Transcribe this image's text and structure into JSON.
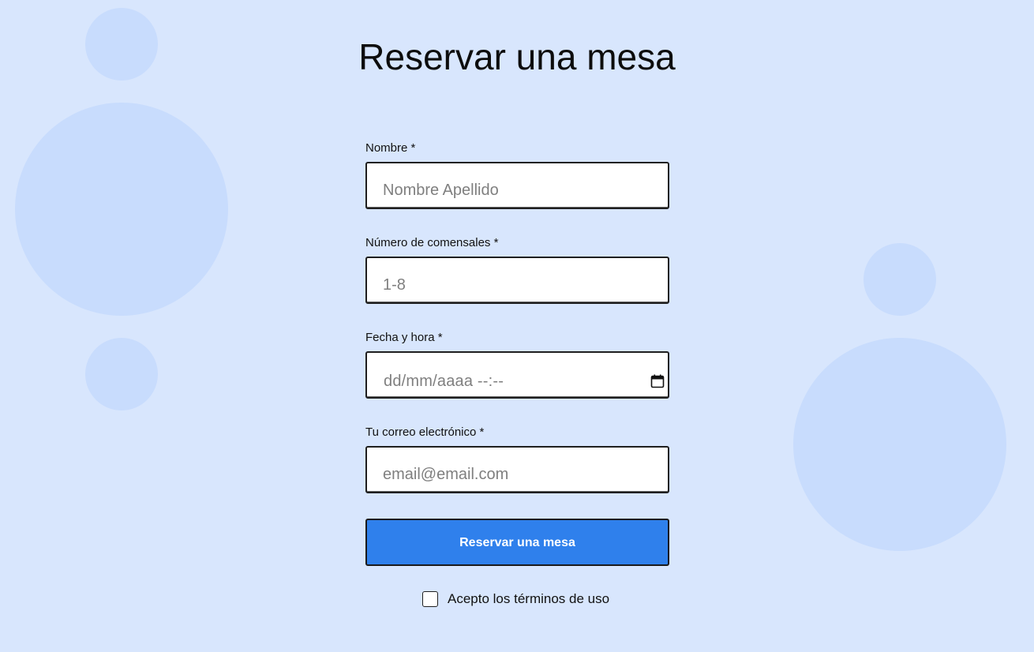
{
  "page": {
    "title": "Reservar una mesa",
    "background_color": "#d8e6fd",
    "decor_color": "#c8dcfd"
  },
  "form": {
    "name": {
      "label": "Nombre *",
      "placeholder": "Nombre Apellido",
      "value": ""
    },
    "guests": {
      "label": "Número de comensales *",
      "placeholder": "1-8",
      "value": ""
    },
    "datetime": {
      "label": "Fecha y hora *",
      "placeholder": "dd/mm/aaaa --:--",
      "icon": "calendar-icon"
    },
    "email": {
      "label": "Tu correo electrónico *",
      "placeholder": "email@email.com",
      "value": ""
    },
    "submit": {
      "label": "Reservar una mesa",
      "color": "#2f80ec"
    },
    "terms": {
      "label": "Acepto los términos de uso",
      "checked": false
    }
  }
}
